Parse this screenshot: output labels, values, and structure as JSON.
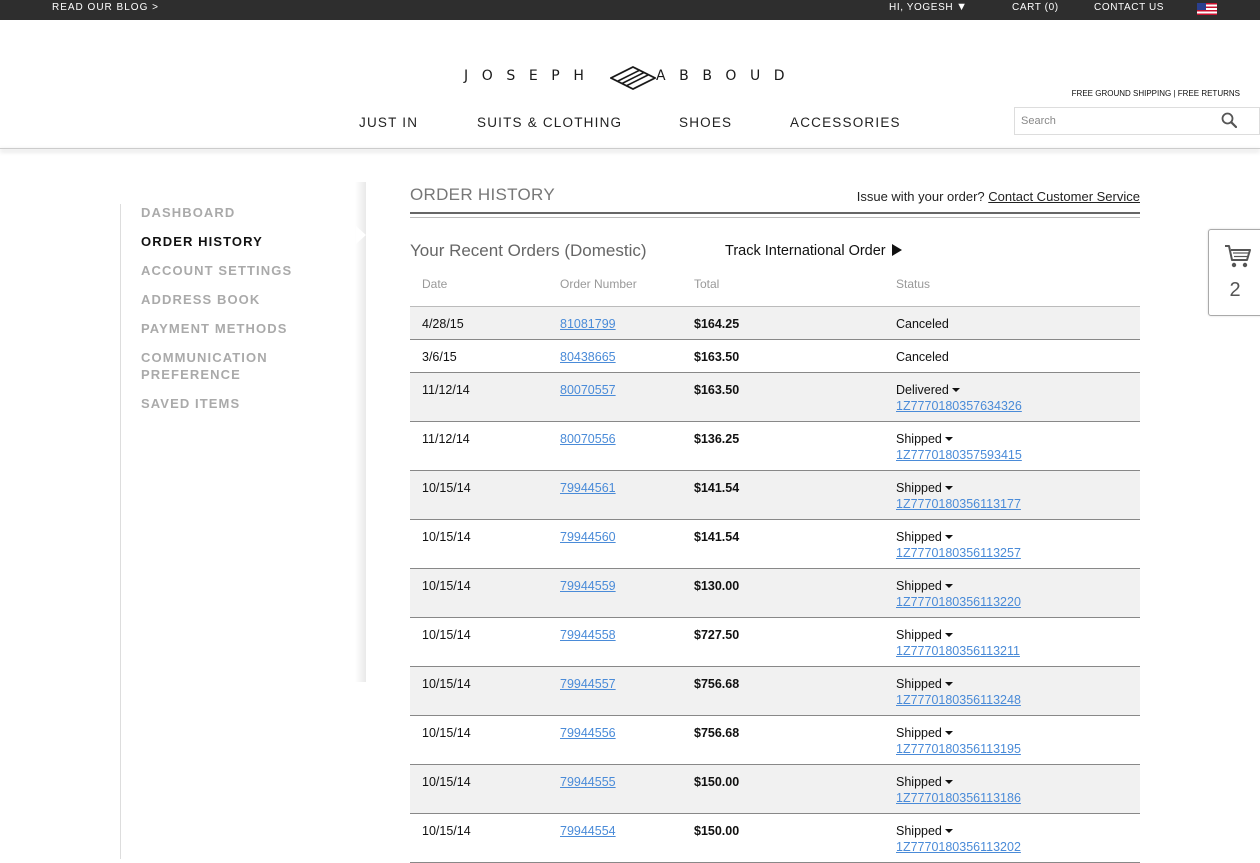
{
  "topbar": {
    "blog": "READ OUR BLOG >",
    "user": "HI, YOGESH",
    "cart": "CART (0)",
    "contact": "CONTACT US"
  },
  "header": {
    "logo_left": "JOSEPH",
    "logo_right": "ABBOUD",
    "shipping_note": "FREE GROUND SHIPPING | FREE RETURNS",
    "nav": {
      "just_in": "JUST IN",
      "suits": "SUITS & CLOTHING",
      "shoes": "SHOES",
      "accessories": "ACCESSORIES"
    },
    "search_placeholder": "Search"
  },
  "sidebar": {
    "dashboard": "DASHBOARD",
    "order_history": "ORDER HISTORY",
    "account_settings": "ACCOUNT SETTINGS",
    "address_book": "ADDRESS BOOK",
    "payment_methods": "PAYMENT METHODS",
    "communication": "COMMUNICATION PREFERENCE",
    "saved_items": "SAVED ITEMS"
  },
  "main": {
    "title": "ORDER HISTORY",
    "issue_text": "Issue with your order?",
    "issue_link": "Contact Customer Service",
    "recent": "Your Recent Orders (Domestic)",
    "track_intl": "Track International Order",
    "columns": {
      "date": "Date",
      "number": "Order Number",
      "total": "Total",
      "status": "Status"
    },
    "orders": [
      {
        "date": "4/28/15",
        "number": "81081799",
        "total": "$164.25",
        "status": "Canceled",
        "tracking": ""
      },
      {
        "date": "3/6/15",
        "number": "80438665",
        "total": "$163.50",
        "status": "Canceled",
        "tracking": ""
      },
      {
        "date": "11/12/14",
        "number": "80070557",
        "total": "$163.50",
        "status": "Delivered",
        "tracking": "1Z7770180357634326"
      },
      {
        "date": "11/12/14",
        "number": "80070556",
        "total": "$136.25",
        "status": "Shipped",
        "tracking": "1Z7770180357593415"
      },
      {
        "date": "10/15/14",
        "number": "79944561",
        "total": "$141.54",
        "status": "Shipped",
        "tracking": "1Z7770180356113177"
      },
      {
        "date": "10/15/14",
        "number": "79944560",
        "total": "$141.54",
        "status": "Shipped",
        "tracking": "1Z7770180356113257"
      },
      {
        "date": "10/15/14",
        "number": "79944559",
        "total": "$130.00",
        "status": "Shipped",
        "tracking": "1Z7770180356113220"
      },
      {
        "date": "10/15/14",
        "number": "79944558",
        "total": "$727.50",
        "status": "Shipped",
        "tracking": "1Z7770180356113211"
      },
      {
        "date": "10/15/14",
        "number": "79944557",
        "total": "$756.68",
        "status": "Shipped",
        "tracking": "1Z7770180356113248"
      },
      {
        "date": "10/15/14",
        "number": "79944556",
        "total": "$756.68",
        "status": "Shipped",
        "tracking": "1Z7770180356113195"
      },
      {
        "date": "10/15/14",
        "number": "79944555",
        "total": "$150.00",
        "status": "Shipped",
        "tracking": "1Z7770180356113186"
      },
      {
        "date": "10/15/14",
        "number": "79944554",
        "total": "$150.00",
        "status": "Shipped",
        "tracking": "1Z7770180356113202"
      }
    ]
  },
  "cart_widget": {
    "count": "2"
  },
  "icons": {
    "flag": "us-flag-icon",
    "search": "search-icon",
    "cart": "cart-icon",
    "user_menu": "caret-down-icon",
    "track": "play-triangle-icon"
  },
  "colors": {
    "topbar": "#2e2e2e",
    "link": "#4a8bd8",
    "row_shade": "#f1f1f1",
    "inactive_nav": "#aaaaaa"
  }
}
